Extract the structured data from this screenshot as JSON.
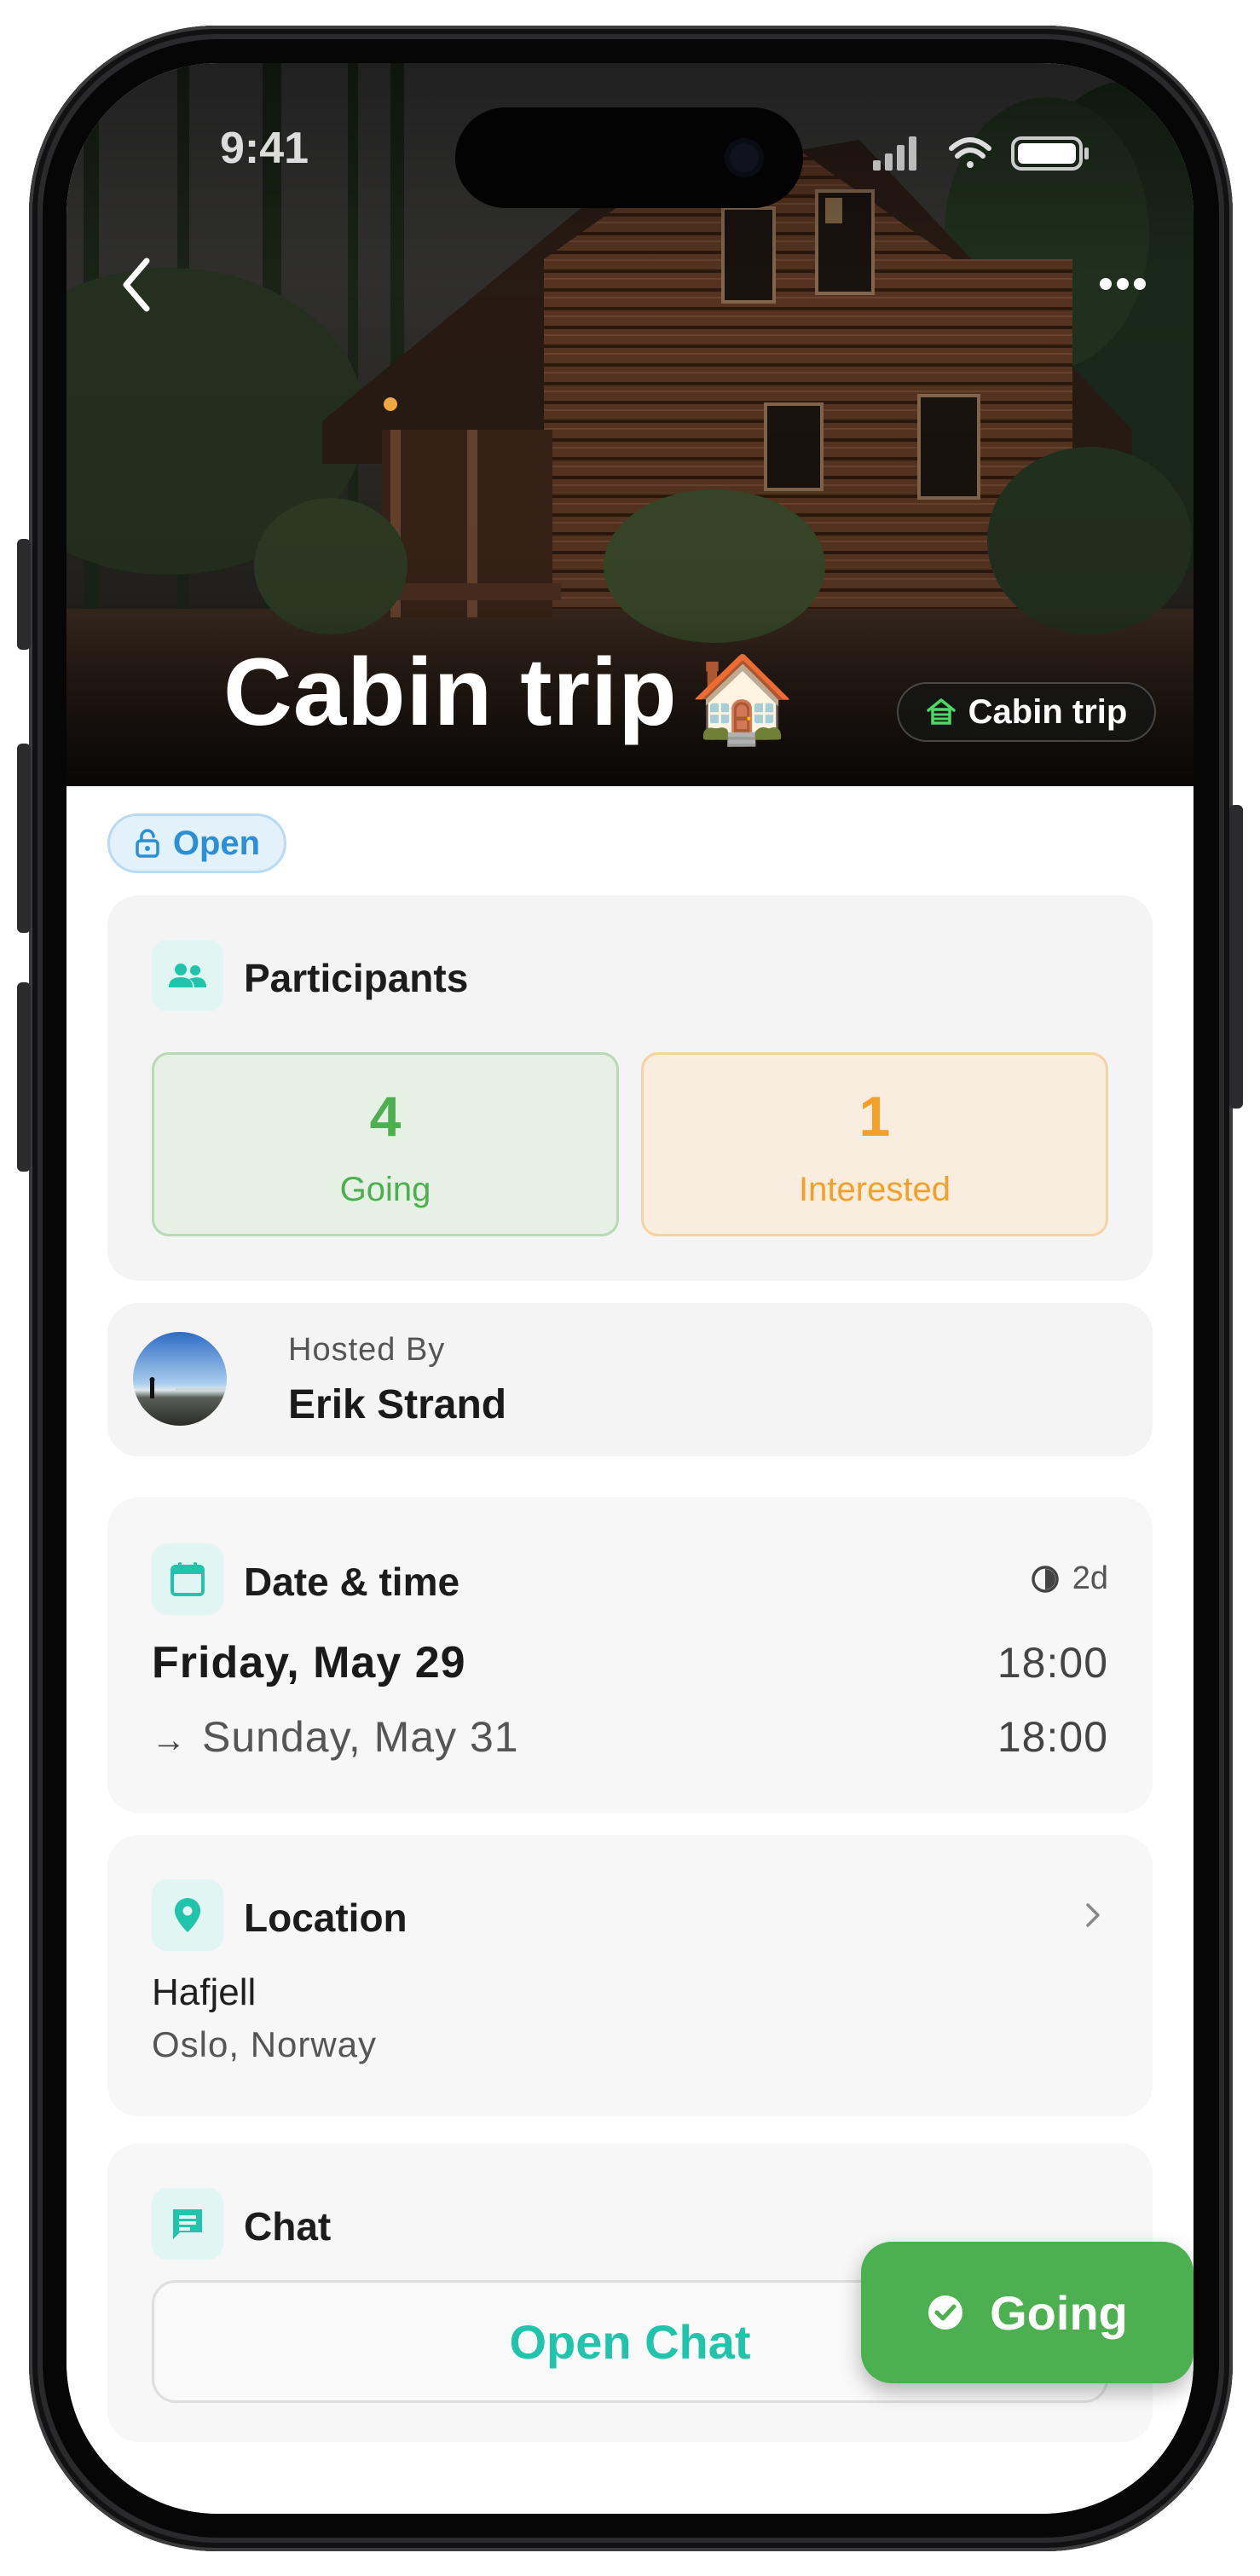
{
  "status_bar": {
    "time": "9:41"
  },
  "hero": {
    "title": "Cabin trip",
    "title_emoji": "🏠",
    "category_badge": "Cabin trip"
  },
  "visibility_badge": "Open",
  "participants": {
    "title": "Participants",
    "going_count": "4",
    "going_label": "Going",
    "interested_count": "1",
    "interested_label": "Interested"
  },
  "host": {
    "caption": "Hosted By",
    "name": "Erik Strand"
  },
  "date_time": {
    "title": "Date & time",
    "duration": "2d",
    "start_date": "Friday, May 29",
    "start_time": "18:00",
    "end_arrow": "→",
    "end_date": "Sunday, May 31",
    "end_time": "18:00"
  },
  "location": {
    "title": "Location",
    "name": "Hafjell",
    "region": "Oslo, Norway"
  },
  "chat": {
    "title": "Chat",
    "open_label": "Open Chat"
  },
  "rsvp_button": {
    "label": "Going"
  },
  "colors": {
    "accent_teal": "#1fc4ab",
    "going_green": "#4caf50",
    "interested_orange": "#f3a02a",
    "open_blue": "#2a8fd8"
  },
  "icons": {
    "back": "chevron-left-icon",
    "more": "more-horizontal-icon",
    "category": "cabin-icon",
    "open": "lock-open-icon",
    "participants": "people-icon",
    "date": "calendar-icon",
    "duration": "clock-half-icon",
    "location": "map-pin-icon",
    "chat": "chat-bubble-icon",
    "rsvp": "check-circle-icon"
  }
}
